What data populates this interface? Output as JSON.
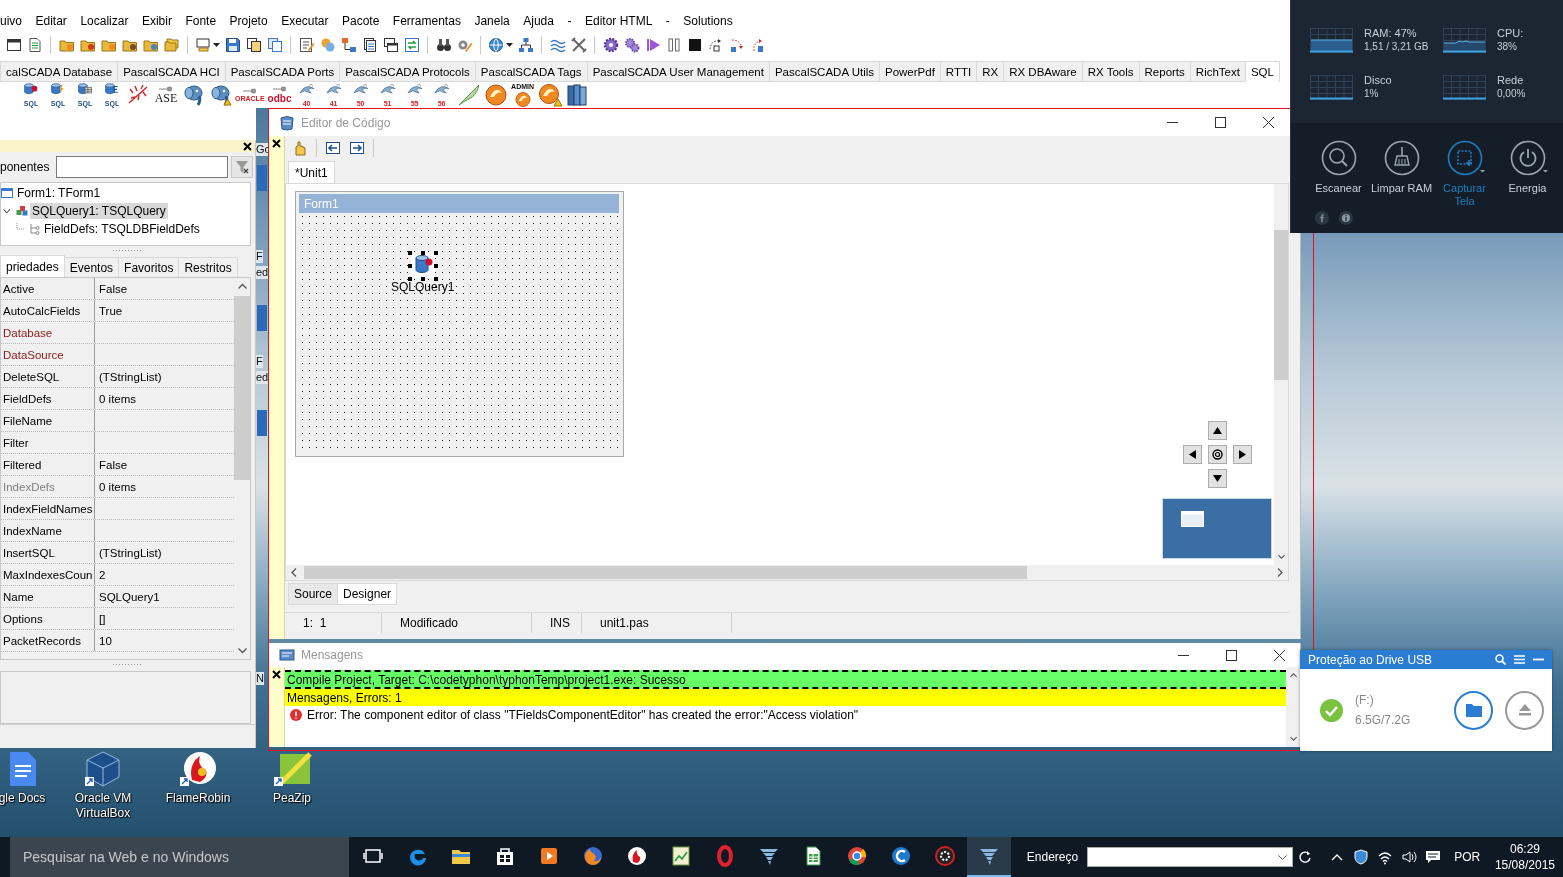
{
  "ide": {
    "menu": [
      "uivo",
      "Editar",
      "Localizar",
      "Exibir",
      "Fonte",
      "Projeto",
      "Executar",
      "Pacote",
      "Ferramentas",
      "Janela",
      "Ajuda",
      "-",
      "Editor HTML",
      "-",
      "Solutions"
    ],
    "palette_tabs": [
      {
        "label": "calSCADA Database",
        "selected": false
      },
      {
        "label": "PascalSCADA HCI",
        "selected": false
      },
      {
        "label": "PascalSCADA Ports",
        "selected": false
      },
      {
        "label": "PascalSCADA Protocols",
        "selected": false
      },
      {
        "label": "PascalSCADA Tags",
        "selected": false
      },
      {
        "label": "PascalSCADA User Management",
        "selected": false
      },
      {
        "label": "PascalSCADA Utils",
        "selected": false
      },
      {
        "label": "PowerPdf",
        "selected": false
      },
      {
        "label": "RTTI",
        "selected": false
      },
      {
        "label": "RX",
        "selected": false
      },
      {
        "label": "RX DBAware",
        "selected": false
      },
      {
        "label": "RX Tools",
        "selected": false
      },
      {
        "label": "Reports",
        "selected": false
      },
      {
        "label": "RichText",
        "selected": false
      },
      {
        "label": "SQL",
        "selected": true
      }
    ],
    "components": [
      {
        "kind": "query",
        "badge": "SQL"
      },
      {
        "kind": "script",
        "badge": "SQL"
      },
      {
        "kind": "table",
        "badge": "SQL"
      },
      {
        "kind": "store",
        "badge": "SQL"
      },
      {
        "kind": "quill"
      },
      {
        "kind": "ase",
        "badge": "ASE"
      },
      {
        "kind": "elephant"
      },
      {
        "kind": "alertelephant"
      },
      {
        "kind": "oracle",
        "badge": "ORACLE"
      },
      {
        "kind": "odbc",
        "badge": "odbc"
      },
      {
        "kind": "dolphin",
        "badge": "40"
      },
      {
        "kind": "dolphin",
        "badge": "41"
      },
      {
        "kind": "dolphin",
        "badge": "50"
      },
      {
        "kind": "dolphin",
        "badge": "51"
      },
      {
        "kind": "dolphin",
        "badge": "55"
      },
      {
        "kind": "dolphin",
        "badge": "56"
      },
      {
        "kind": "leaf"
      },
      {
        "kind": "firebird"
      },
      {
        "kind": "admin",
        "badge": "ADMIN"
      },
      {
        "kind": "alertbird"
      },
      {
        "kind": "books"
      }
    ]
  },
  "desktop_fragments": [
    "Go",
    "F",
    "ed",
    "F",
    "ed",
    "N"
  ],
  "inspector": {
    "filter_label": "ponentes",
    "tree": [
      {
        "label": "Form1: TForm1",
        "kind": "form",
        "selected": false,
        "children": [
          {
            "label": "SQLQuery1: TSQLQuery",
            "kind": "query",
            "selected": true,
            "expanded": true,
            "children": [
              {
                "label": "FieldDefs: TSQLDBFieldDefs",
                "kind": "fielddefs",
                "selected": false
              }
            ]
          }
        ]
      }
    ],
    "tabs": [
      {
        "label": "priedades",
        "selected": true
      },
      {
        "label": "Eventos",
        "selected": false
      },
      {
        "label": "Favoritos",
        "selected": false
      },
      {
        "label": "Restritos",
        "selected": false
      }
    ],
    "properties": [
      {
        "name": "Active",
        "value": "False",
        "kind": "normal"
      },
      {
        "name": "AutoCalcFields",
        "value": "True",
        "kind": "normal"
      },
      {
        "name": "Database",
        "kind": "reference"
      },
      {
        "name": "DataSource",
        "kind": "reference"
      },
      {
        "name": "DeleteSQL",
        "value": "(TStringList)",
        "kind": "normal"
      },
      {
        "name": "FieldDefs",
        "value": "0 items",
        "kind": "normal"
      },
      {
        "name": "FileName",
        "kind": "normal"
      },
      {
        "name": "Filter",
        "kind": "normal"
      },
      {
        "name": "Filtered",
        "value": "False",
        "kind": "normal"
      },
      {
        "name": "IndexDefs",
        "value": "0 items",
        "kind": "readonly"
      },
      {
        "name": "IndexFieldNames",
        "kind": "normal"
      },
      {
        "name": "IndexName",
        "kind": "normal"
      },
      {
        "name": "InsertSQL",
        "value": "(TStringList)",
        "kind": "normal"
      },
      {
        "name": "MaxIndexesCoun",
        "value": "2",
        "kind": "normal"
      },
      {
        "name": "Name",
        "value": "SQLQuery1",
        "kind": "normal"
      },
      {
        "name": "Options",
        "value": "[]",
        "kind": "normal"
      },
      {
        "name": "PacketRecords",
        "value": "10",
        "kind": "normal"
      }
    ]
  },
  "editor": {
    "title": "Editor de Código",
    "tabs": [
      {
        "label": "*Unit1",
        "selected": true
      }
    ],
    "form": {
      "caption": "Form1",
      "component": "SQLQuery1"
    },
    "view_tabs": [
      {
        "label": "Source",
        "selected": false
      },
      {
        "label": "Designer",
        "selected": true
      }
    ],
    "status": [
      "1:  1",
      "Modificado",
      "INS",
      "unit1.pas"
    ]
  },
  "messages": {
    "title": "Mensagens",
    "rows": [
      {
        "kind": "success",
        "text": "Compile Project, Target: C:\\codetyphon\\typhonTemp\\project1.exe: Sucesso"
      },
      {
        "kind": "summary",
        "text": "Mensagens, Errors: 1"
      },
      {
        "kind": "error",
        "text": "Error: The component editor of class \"TFieldsComponentEditor\" has created the error:\"Access violation\""
      }
    ]
  },
  "monitor": {
    "stats": [
      {
        "label": "RAM: 47%",
        "detail": "1,51 / 3,21 GB",
        "kind": "area"
      },
      {
        "label": "CPU:",
        "detail": "38%",
        "kind": "line"
      },
      {
        "label": "Disco",
        "detail": "1%",
        "kind": "flat"
      },
      {
        "label": "Rede",
        "detail": "0,00%",
        "kind": "flat"
      }
    ],
    "actions": [
      {
        "label": "Escanear",
        "kind": "scan",
        "selected": false,
        "dropdown": false
      },
      {
        "label": "Limpar RAM",
        "kind": "clean",
        "selected": false,
        "dropdown": false
      },
      {
        "label": "Capturar Tela",
        "kind": "capture",
        "selected": true,
        "dropdown": true
      },
      {
        "label": "Energia",
        "kind": "power",
        "selected": false,
        "dropdown": true
      }
    ]
  },
  "usb": {
    "title": "Proteção ao Drive USB",
    "drive": "(F:)",
    "usage": "6.5G/7.2G"
  },
  "desktop_icons": [
    {
      "label": "gle Docs",
      "kind": "docs"
    },
    {
      "label": "Oracle VM VirtualBox",
      "kind": "virtualbox"
    },
    {
      "label": "FlameRobin",
      "kind": "flamerobin"
    },
    {
      "label": "PeaZip",
      "kind": "peazip"
    }
  ],
  "taskbar": {
    "search": {
      "placeholder": "Pesquisar na Web e no Windows"
    },
    "apps": [
      {
        "kind": "taskview",
        "active": false
      },
      {
        "kind": "edge",
        "active": false
      },
      {
        "kind": "explorer",
        "active": false
      },
      {
        "kind": "store",
        "active": false
      },
      {
        "kind": "media",
        "active": false
      },
      {
        "kind": "firefox",
        "active": false
      },
      {
        "kind": "flamerobin",
        "active": false
      },
      {
        "kind": "chartdoc",
        "active": false
      },
      {
        "kind": "opera",
        "active": false
      },
      {
        "kind": "typhon",
        "active": false
      },
      {
        "kind": "calc",
        "active": false
      },
      {
        "kind": "chrome",
        "active": false
      },
      {
        "kind": "ccleaner",
        "active": false
      },
      {
        "kind": "redapp",
        "active": false
      },
      {
        "kind": "typhon",
        "active": true
      }
    ],
    "address_label": "Endereço",
    "language": "POR",
    "time": "06:29",
    "date": "15/08/2015"
  }
}
